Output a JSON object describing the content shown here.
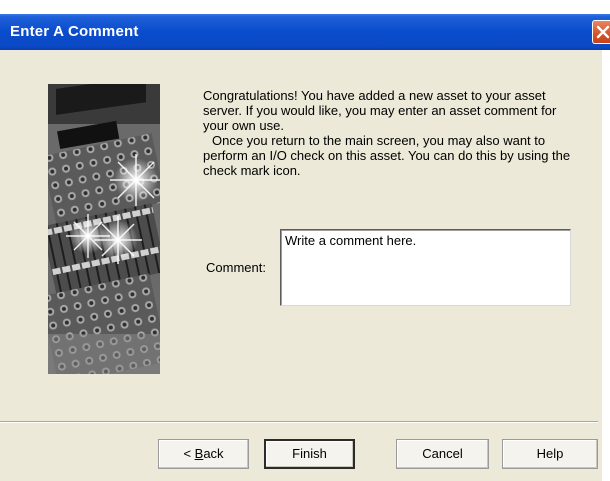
{
  "window": {
    "title": "Enter A Comment",
    "close_icon": "close-icon"
  },
  "message": {
    "paragraph1": "Congratulations!  You have added a new asset to your asset server.  If you would like, you may enter an asset comment for your own use.",
    "paragraph2": "Once you return to the main screen, you may also want to perform an I/O check on this asset.  You can do this by using the check mark icon."
  },
  "comment": {
    "label": "Comment:",
    "value": "Write a comment here."
  },
  "buttons": {
    "back_prefix": "< ",
    "back_mnemonic": "B",
    "back_rest": "ack",
    "finish": "Finish",
    "cancel": "Cancel",
    "help": "Help"
  },
  "colors": {
    "titlebar": "#0a4ccd",
    "close_button": "#d4532a",
    "dialog_face": "#ece9d8"
  }
}
